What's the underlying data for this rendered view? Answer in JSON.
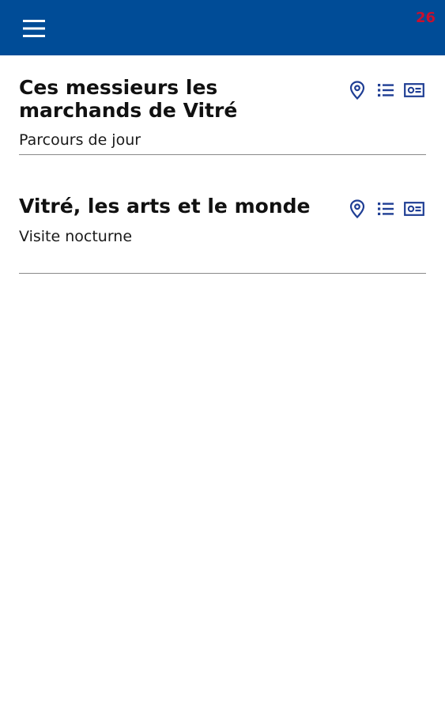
{
  "header": {
    "menu_icon": "hamburger-menu-icon",
    "counter": "26",
    "bar_color": "#004c97",
    "counter_color": "#c8102e"
  },
  "tours": [
    {
      "title": "Ces messieurs les marchands de Vitré",
      "subtitle": "Parcours de jour",
      "actions": [
        "map-pin-icon",
        "list-icon",
        "id-card-icon"
      ]
    },
    {
      "title": "Vitré, les arts et le monde",
      "subtitle": "Visite nocturne",
      "actions": [
        "map-pin-icon",
        "list-icon",
        "id-card-icon"
      ]
    }
  ],
  "icon_color": "#1f3e94"
}
